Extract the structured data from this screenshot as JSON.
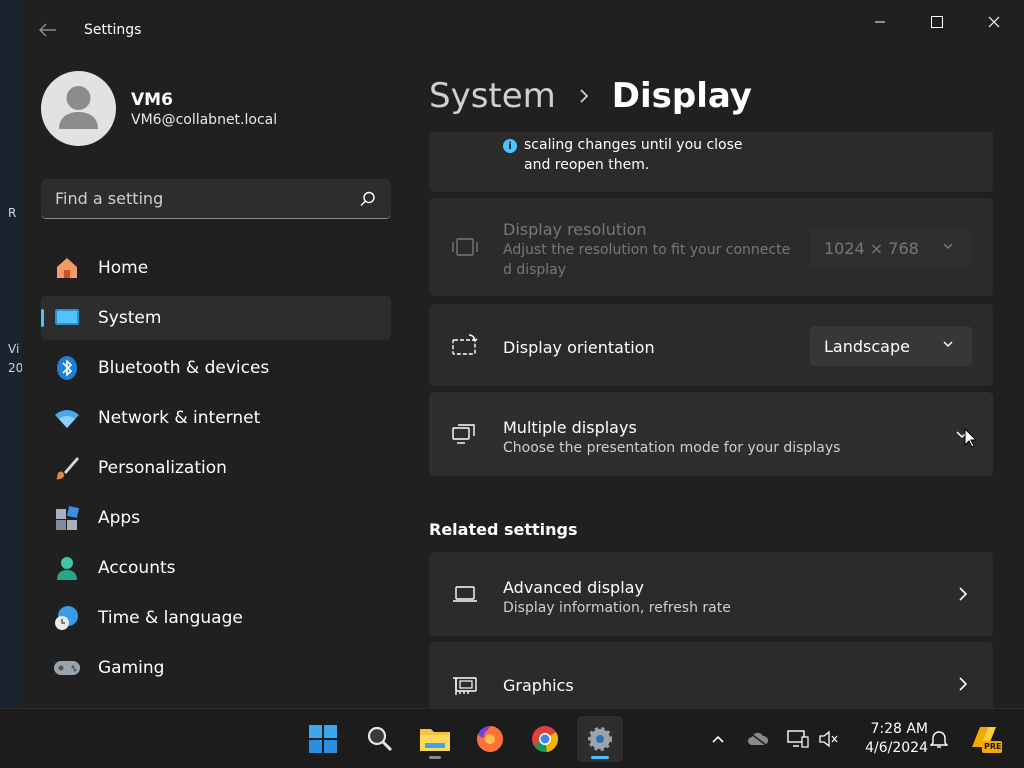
{
  "desktop": {
    "edge_text": [
      "R",
      "Vi",
      "20"
    ]
  },
  "window": {
    "title": "Settings"
  },
  "user": {
    "name": "VM6",
    "email": "VM6@collabnet.local"
  },
  "search": {
    "placeholder": "Find a setting"
  },
  "nav": {
    "items": [
      {
        "label": "Home",
        "icon": "home-icon",
        "active": false
      },
      {
        "label": "System",
        "icon": "system-icon",
        "active": true
      },
      {
        "label": "Bluetooth & devices",
        "icon": "bluetooth-icon",
        "active": false
      },
      {
        "label": "Network & internet",
        "icon": "wifi-icon",
        "active": false
      },
      {
        "label": "Personalization",
        "icon": "paintbrush-icon",
        "active": false
      },
      {
        "label": "Apps",
        "icon": "apps-icon",
        "active": false
      },
      {
        "label": "Accounts",
        "icon": "accounts-icon",
        "active": false
      },
      {
        "label": "Time & language",
        "icon": "clock-globe-icon",
        "active": false
      },
      {
        "label": "Gaming",
        "icon": "gamepad-icon",
        "active": false
      }
    ]
  },
  "breadcrumb": {
    "parent": "System",
    "current": "Display"
  },
  "content": {
    "scaling_note": "scaling changes until you close and reopen them.",
    "resolution": {
      "title": "Display resolution",
      "subtitle_line1": "Adjust the resolution to fit your connecte",
      "subtitle_line2": "d display",
      "value": "1024 × 768"
    },
    "orientation": {
      "title": "Display orientation",
      "value": "Landscape"
    },
    "multiple": {
      "title": "Multiple displays",
      "subtitle": "Choose the presentation mode for your displays"
    },
    "related_title": "Related settings",
    "advanced": {
      "title": "Advanced display",
      "subtitle": "Display information, refresh rate"
    },
    "graphics": {
      "title": "Graphics"
    }
  },
  "taskbar": {
    "apps": [
      "start-icon",
      "search-icon",
      "file-explorer-icon",
      "firefox-icon",
      "chrome-icon",
      "settings-icon"
    ],
    "time": "7:28 AM",
    "date": "4/6/2024",
    "badge": "PRE"
  },
  "colors": {
    "accent": "#4cc2ff",
    "window_bg": "#202020",
    "card_bg": "#2b2b2b"
  }
}
